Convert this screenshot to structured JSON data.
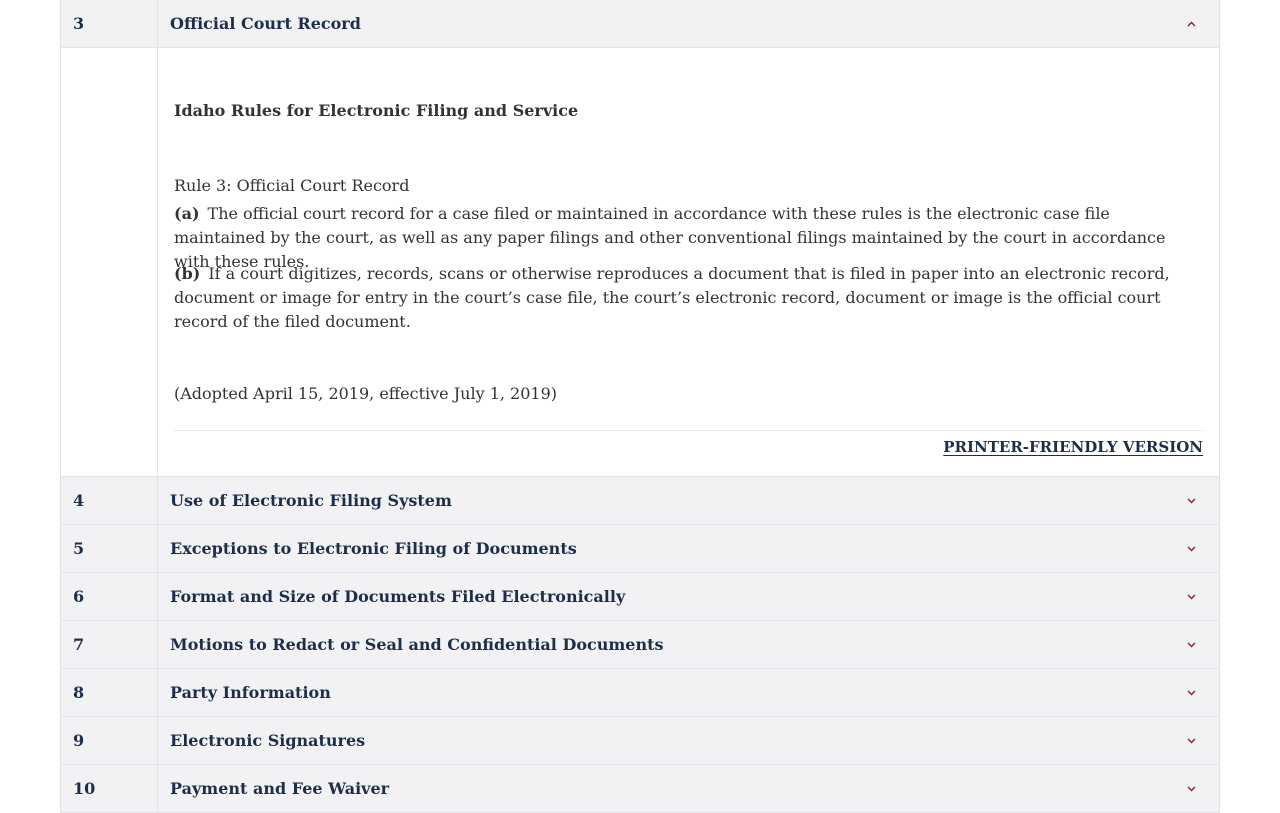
{
  "accordion": {
    "open_item": {
      "number": "3",
      "title": "Official Court Record",
      "heading": "Idaho Rules for Electronic Filing and Service",
      "rule_name": "Rule 3: Official Court Record",
      "para_a_label": "(a)",
      "para_a_text": "The official court record for a case filed or maintained in accordance with these rules is the electronic case file maintained by the court, as well as any paper filings and other conventional filings maintained by the court in accordance with these rules.",
      "para_b_label": "(b)",
      "para_b_text": "If a court digitizes, records, scans or otherwise reproduces a document that is filed in paper into an electronic record, document or image for entry in the court’s case file, the court’s electronic record, document or image is the official court record of the filed document.",
      "adopted": "(Adopted April 15, 2019, effective July 1, 2019)",
      "printer_link": "PRINTER-FRIENDLY VERSION"
    },
    "items": [
      {
        "number": "4",
        "title": "Use of Electronic Filing System"
      },
      {
        "number": "5",
        "title": "Exceptions to Electronic Filing of Documents"
      },
      {
        "number": "6",
        "title": "Format and Size of Documents Filed Electronically"
      },
      {
        "number": "7",
        "title": "Motions to Redact or Seal and Confidential Documents"
      },
      {
        "number": "8",
        "title": "Party Information"
      },
      {
        "number": "9",
        "title": "Electronic Signatures"
      },
      {
        "number": "10",
        "title": "Payment and Fee Waiver"
      }
    ]
  },
  "colors": {
    "header_bg": "#f2f2f4",
    "title_text": "#1c2e4a",
    "chevron": "#8a1c2b"
  },
  "icons": {
    "open": "chevron-up-icon",
    "closed": "chevron-down-icon"
  }
}
